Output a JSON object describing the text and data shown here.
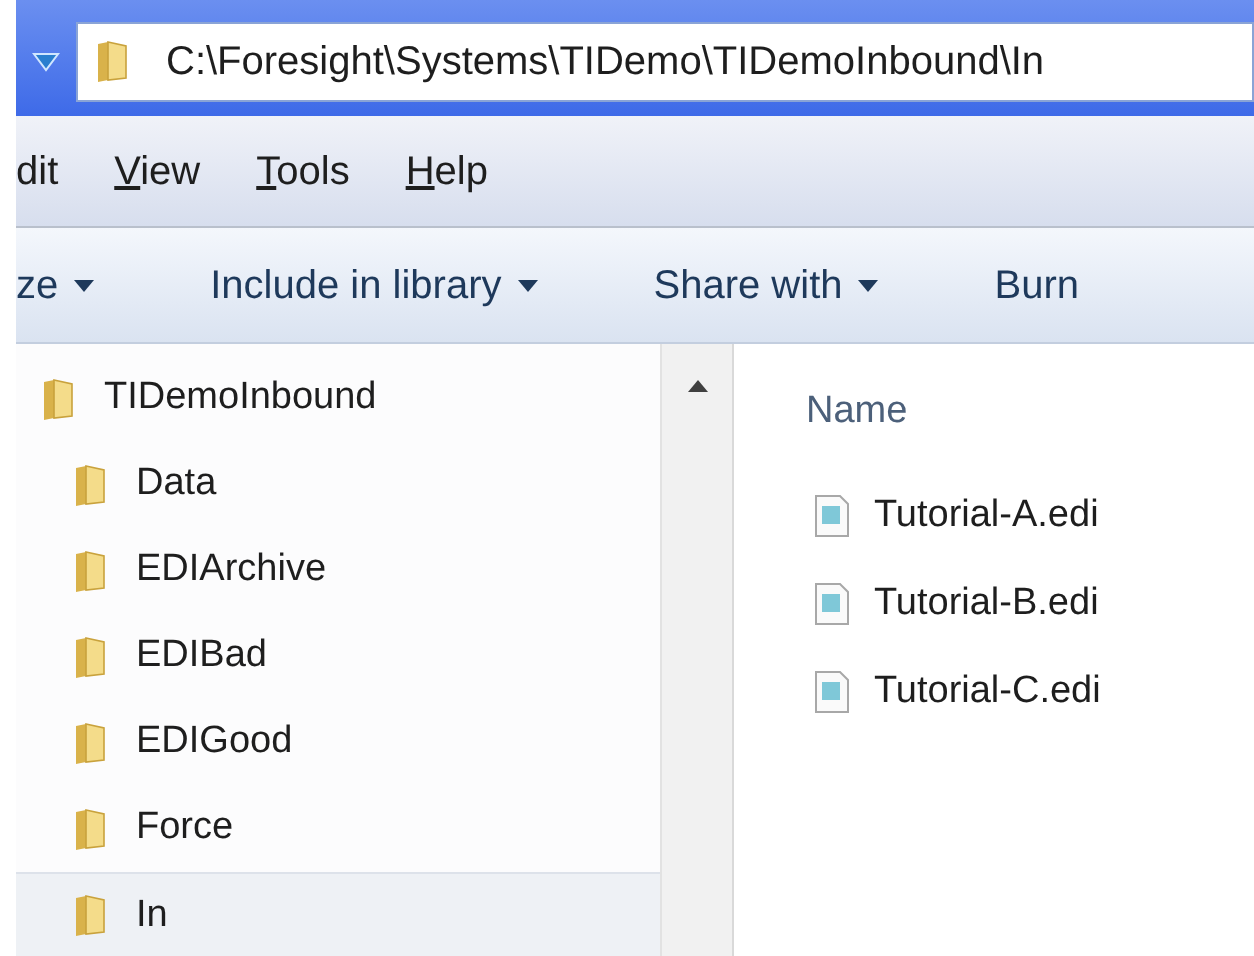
{
  "address_bar": {
    "path": "C:\\Foresight\\Systems\\TIDemo\\TIDemoInbound\\In"
  },
  "menu": [
    {
      "rest": "dit"
    },
    {
      "mnemonic": "V",
      "rest": "iew"
    },
    {
      "mnemonic": "T",
      "rest": "ools"
    },
    {
      "mnemonic": "H",
      "rest": "elp"
    }
  ],
  "toolbar": [
    {
      "label": "ze",
      "dropdown": true
    },
    {
      "label": "Include in library",
      "dropdown": true
    },
    {
      "label": "Share with",
      "dropdown": true
    },
    {
      "label": "Burn",
      "dropdown": false
    }
  ],
  "tree": [
    {
      "label": "TIDemoInbound",
      "selected": false,
      "children": [
        {
          "label": "Data",
          "selected": false
        },
        {
          "label": "EDIArchive",
          "selected": false
        },
        {
          "label": "EDIBad",
          "selected": false
        },
        {
          "label": "EDIGood",
          "selected": false
        },
        {
          "label": "Force",
          "selected": false
        },
        {
          "label": "In",
          "selected": true
        }
      ]
    }
  ],
  "file_list": {
    "column": "Name",
    "files": [
      "Tutorial-A.edi",
      "Tutorial-B.edi",
      "Tutorial-C.edi"
    ]
  }
}
